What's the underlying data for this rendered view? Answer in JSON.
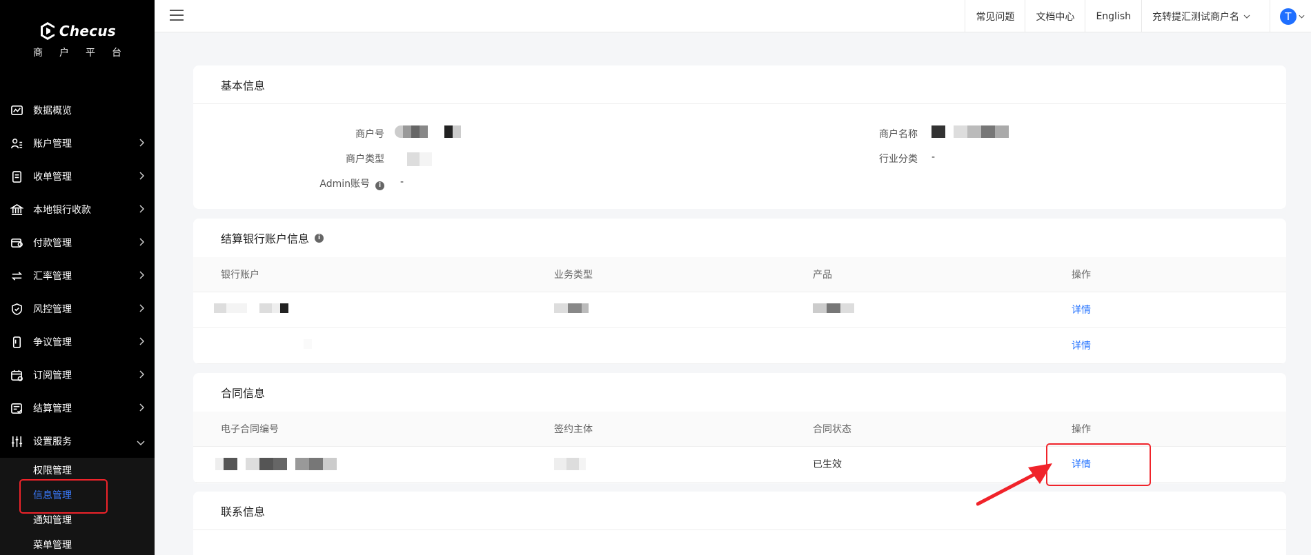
{
  "brand": {
    "name": "Checus",
    "subtitle": "商户平台"
  },
  "sidebar": {
    "items": [
      {
        "label": "数据概览",
        "icon": "chart-icon",
        "has_children": false
      },
      {
        "label": "账户管理",
        "icon": "users-icon",
        "has_children": true
      },
      {
        "label": "收单管理",
        "icon": "document-icon",
        "has_children": true
      },
      {
        "label": "本地银行收款",
        "icon": "bank-icon",
        "has_children": true
      },
      {
        "label": "付款管理",
        "icon": "payment-icon",
        "has_children": true
      },
      {
        "label": "汇率管理",
        "icon": "exchange-icon",
        "has_children": true
      },
      {
        "label": "风控管理",
        "icon": "shield-icon",
        "has_children": true
      },
      {
        "label": "争议管理",
        "icon": "phone-icon",
        "has_children": true
      },
      {
        "label": "订阅管理",
        "icon": "calendar-icon",
        "has_children": true
      },
      {
        "label": "结算管理",
        "icon": "settlement-icon",
        "has_children": true
      },
      {
        "label": "设置服务",
        "icon": "sliders-icon",
        "has_children": true,
        "expanded": true
      }
    ],
    "sub_items": [
      {
        "label": "权限管理",
        "active": false
      },
      {
        "label": "信息管理",
        "active": true
      },
      {
        "label": "通知管理",
        "active": false
      },
      {
        "label": "菜单管理",
        "active": false
      }
    ]
  },
  "header": {
    "faq": "常见问题",
    "docs": "文档中心",
    "language": "English",
    "merchant_name": "充转提汇测试商户名",
    "avatar_letter": "T"
  },
  "basic_info": {
    "title": "基本信息",
    "merchant_no_label": "商户号",
    "merchant_type_label": "商户类型",
    "admin_label": "Admin账号",
    "admin_value": "-",
    "merchant_name_label": "商户名称",
    "industry_label": "行业分类",
    "industry_value": "-"
  },
  "bank_info": {
    "title": "结算银行账户信息",
    "columns": [
      "银行账户",
      "业务类型",
      "产品",
      "操作"
    ],
    "rows": [
      {
        "action": "详情"
      },
      {
        "action": "详情"
      }
    ]
  },
  "contract_info": {
    "title": "合同信息",
    "columns": [
      "电子合同编号",
      "签约主体",
      "合同状态",
      "操作"
    ],
    "rows": [
      {
        "status": "已生效",
        "action": "详情"
      }
    ]
  },
  "contact_info": {
    "title": "联系信息"
  },
  "colors": {
    "accent": "#1f6fff",
    "sidebar_bg": "#000000",
    "highlight": "#f0232a"
  }
}
